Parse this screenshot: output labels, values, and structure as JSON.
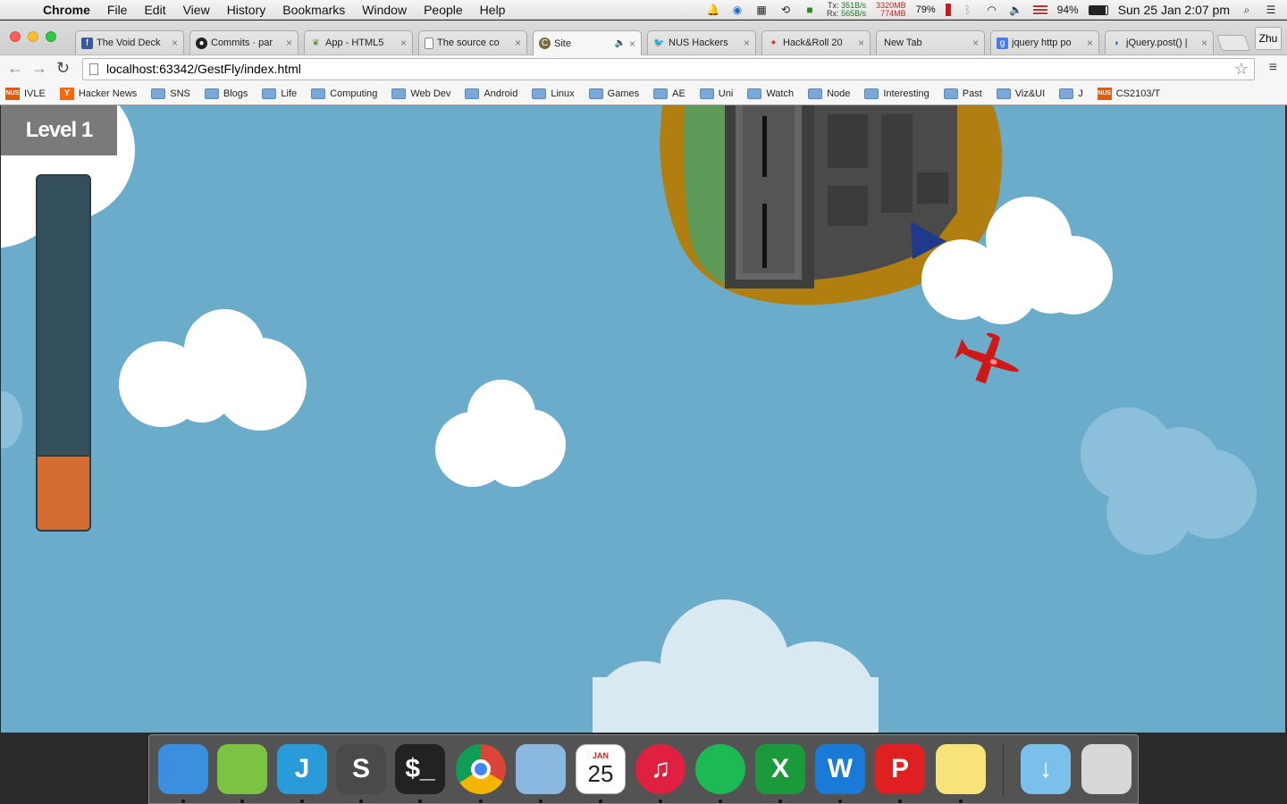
{
  "menubar": {
    "app": "Chrome",
    "items": [
      "File",
      "Edit",
      "View",
      "History",
      "Bookmarks",
      "Window",
      "People",
      "Help"
    ],
    "net_tx_label": "Tx:",
    "net_tx": "351B/s",
    "net_rx_label": "Rx:",
    "net_rx": "565B/s",
    "mem_used": "3320MB",
    "mem_free": "774MB",
    "cpu": "79%",
    "battery": "94%",
    "clock": "Sun 25 Jan  2:07 pm"
  },
  "tabs": [
    {
      "title": "The Void Deck",
      "icon": "facebook-icon",
      "color": "#3b5998"
    },
    {
      "title": "Commits · par",
      "icon": "github-icon",
      "color": "#222222"
    },
    {
      "title": "App - HTML5",
      "icon": "leaf-icon",
      "color": "#5a9a2a"
    },
    {
      "title": "The source co",
      "icon": "page-icon",
      "color": "#ffffff"
    },
    {
      "title": "Site",
      "icon": "site-icon",
      "color": "#7a6a40"
    },
    {
      "title": "NUS Hackers",
      "icon": "twitter-icon",
      "color": "#55acee"
    },
    {
      "title": "Hack&Roll 20",
      "icon": "hackroll-icon",
      "color": "#d03030"
    },
    {
      "title": "New Tab",
      "icon": "",
      "color": ""
    },
    {
      "title": "jquery http po",
      "icon": "google-icon",
      "color": "#4a7be0"
    },
    {
      "title": "jQuery.post() |",
      "icon": "jquery-icon",
      "color": "#1a5fa8"
    }
  ],
  "active_tab": 4,
  "profile": "Zhu",
  "address": "localhost:63342/GestFly/index.html",
  "bookmarks": [
    {
      "label": "IVLE",
      "type": "nus"
    },
    {
      "label": "Hacker News",
      "type": "hn"
    },
    {
      "label": "SNS",
      "type": "folder"
    },
    {
      "label": "Blogs",
      "type": "folder"
    },
    {
      "label": "Life",
      "type": "folder"
    },
    {
      "label": "Computing",
      "type": "folder"
    },
    {
      "label": "Web Dev",
      "type": "folder"
    },
    {
      "label": "Android",
      "type": "folder"
    },
    {
      "label": "Linux",
      "type": "folder"
    },
    {
      "label": "Games",
      "type": "folder"
    },
    {
      "label": "AE",
      "type": "folder"
    },
    {
      "label": "Uni",
      "type": "folder"
    },
    {
      "label": "Watch",
      "type": "folder"
    },
    {
      "label": "Node",
      "type": "folder"
    },
    {
      "label": "Interesting",
      "type": "folder"
    },
    {
      "label": "Past",
      "type": "folder"
    },
    {
      "label": "Viz&UI",
      "type": "folder"
    },
    {
      "label": "J",
      "type": "folder"
    },
    {
      "label": "CS2103/T",
      "type": "nus"
    }
  ],
  "game": {
    "level_label": "Level 1",
    "meter_fraction": 0.21,
    "sky_color": "#6aacca",
    "meter_color": "#d56d32",
    "plane_color": "#d01818"
  },
  "dock": [
    {
      "name": "finder-icon",
      "color": "#3b8fe0",
      "label": ""
    },
    {
      "name": "android-studio-icon",
      "color": "#7cc243",
      "label": ""
    },
    {
      "name": "intellij-icon",
      "color": "#2a9bd8",
      "label": "J"
    },
    {
      "name": "sublime-text-icon",
      "color": "#4a4a4a",
      "label": "S"
    },
    {
      "name": "terminal-icon",
      "color": "#222222",
      "label": "$_"
    },
    {
      "name": "chrome-icon",
      "color": "#e8e8e8",
      "label": ""
    },
    {
      "name": "mail-icon",
      "color": "#8ab8e0",
      "label": ""
    },
    {
      "name": "calendar-icon",
      "color": "#ffffff",
      "label": "25",
      "sub": "JAN"
    },
    {
      "name": "itunes-icon",
      "color": "#e02040",
      "label": "♫"
    },
    {
      "name": "spotify-icon",
      "color": "#1db954",
      "label": ""
    },
    {
      "name": "excel-icon",
      "color": "#1a9a3a",
      "label": "X"
    },
    {
      "name": "word-icon",
      "color": "#1a7ad8",
      "label": "W"
    },
    {
      "name": "powerpoint-icon",
      "color": "#e02020",
      "label": "P"
    },
    {
      "name": "notes-icon",
      "color": "#f8e27a",
      "label": ""
    },
    {
      "name": "downloads-icon",
      "color": "#7ac0ea",
      "label": "↓"
    },
    {
      "name": "trash-icon",
      "color": "#d8d8d8",
      "label": ""
    }
  ]
}
